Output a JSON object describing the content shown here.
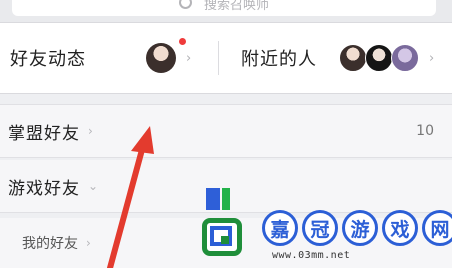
{
  "search": {
    "placeholder": "搜索召唤师"
  },
  "feed": {
    "friends_activity_label": "好友动态",
    "nearby_label": "附近的人"
  },
  "groups": [
    {
      "label": "掌盟好友",
      "count": "10"
    },
    {
      "label": "游戏好友",
      "count": ""
    }
  ],
  "subgroup": {
    "label": "我的好友"
  },
  "watermark": {
    "characters": [
      "嘉",
      "冠",
      "游",
      "戏",
      "网"
    ],
    "url": "www.03mm.net",
    "colors": {
      "blue": "#2c5fd6",
      "green": "#1f8e3a"
    }
  },
  "annotation": {
    "arrow_color": "#e33b2e"
  },
  "colors": {
    "notification_dot": "#ef3b3b"
  }
}
